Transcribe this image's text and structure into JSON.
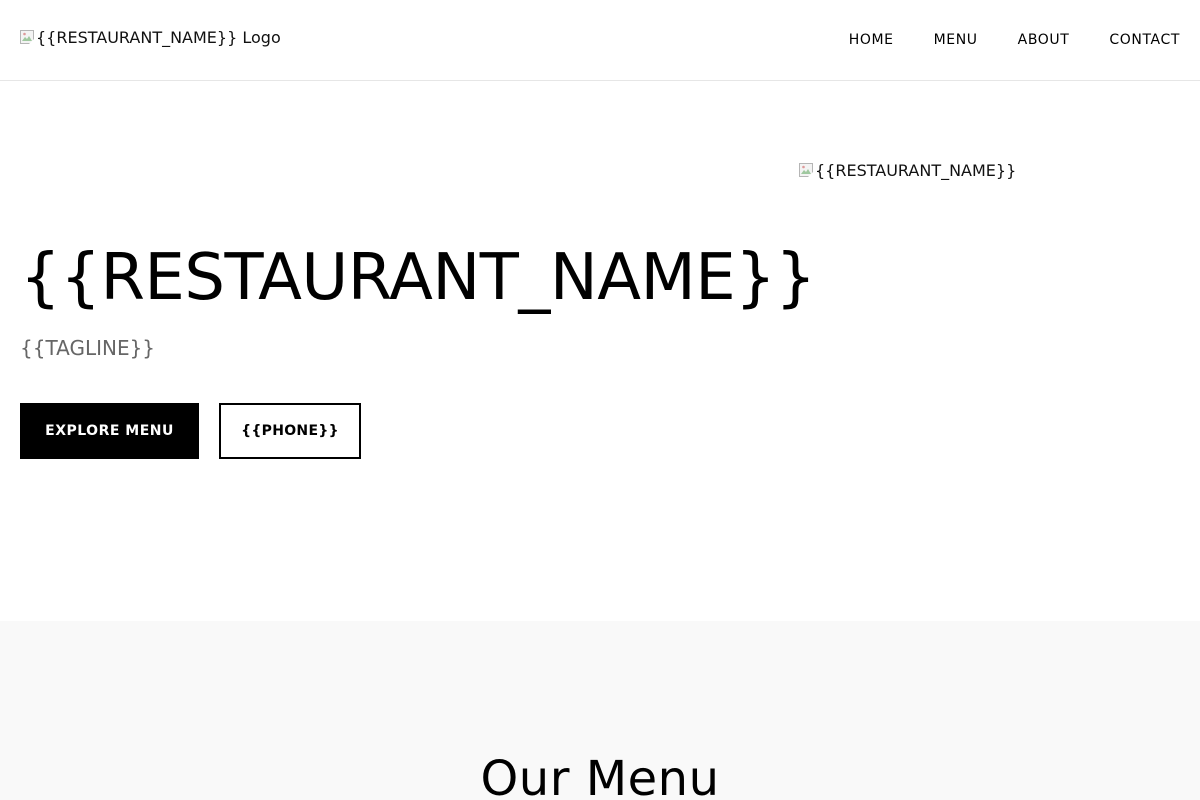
{
  "header": {
    "logo_alt": "{{RESTAURANT_NAME}} Logo",
    "nav": [
      {
        "label": "HOME"
      },
      {
        "label": "MENU"
      },
      {
        "label": "ABOUT"
      },
      {
        "label": "CONTACT"
      }
    ]
  },
  "hero": {
    "title": "{{RESTAURANT_NAME}}",
    "tagline": "{{TAGLINE}}",
    "primary_button": "EXPLORE MENU",
    "secondary_button": "{{PHONE}}",
    "image_alt": "{{RESTAURANT_NAME}}"
  },
  "menu_section": {
    "title": "Our Menu"
  },
  "colors": {
    "background": "#ffffff",
    "section_background": "#f9f9f9",
    "primary": "#000000",
    "muted_text": "#666666",
    "border": "#e6e6e6"
  },
  "icons": {
    "logo_image": "broken-image-icon",
    "hero_image": "broken-image-icon"
  }
}
